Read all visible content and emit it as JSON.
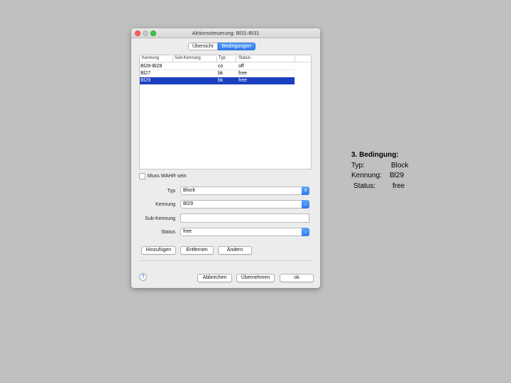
{
  "window": {
    "title": "Aktionssteuerung: Bl31-Bl31"
  },
  "tabs": [
    {
      "label": "Übersicht",
      "active": false
    },
    {
      "label": "Bedingungen",
      "active": true
    }
  ],
  "table": {
    "columns": [
      "Kennung",
      "Sub-Kennung",
      "Typ",
      "Status"
    ],
    "rows": [
      {
        "kennung": "Bl28-Bl28",
        "sub": "",
        "typ": "co",
        "status": "off"
      },
      {
        "kennung": "Bl27",
        "sub": "",
        "typ": "bk",
        "status": "free"
      },
      {
        "kennung": "Bl29",
        "sub": "",
        "typ": "bk",
        "status": "free",
        "selected": true
      }
    ]
  },
  "form": {
    "checkbox_label": "Muss WAHR sein",
    "checkbox_checked": false,
    "typ_label": "Typ",
    "typ_value": "Block",
    "kennung_label": "Kennung",
    "kennung_value": "Bl29",
    "subkennung_label": "Sub-Kennung",
    "subkennung_value": "",
    "status_label": "Status",
    "status_value": "free"
  },
  "actions": {
    "add": "Hinzufügen",
    "remove": "Entfernen",
    "change": "Ändern"
  },
  "footer": {
    "help": "?",
    "cancel": "Abbrechen",
    "apply": "Übernehmen",
    "ok": "ok"
  },
  "note": {
    "heading": "3. Bedingung:",
    "typ_label": "Typ:",
    "typ_value": "Block",
    "kennung_label": "Kennung:",
    "kennung_value": "Bl29",
    "status_label": "Status:",
    "status_value": "free"
  },
  "colors": {
    "accent": "#2e7bf2",
    "selection": "#1a3fbf",
    "background": "#c0c0c0"
  }
}
